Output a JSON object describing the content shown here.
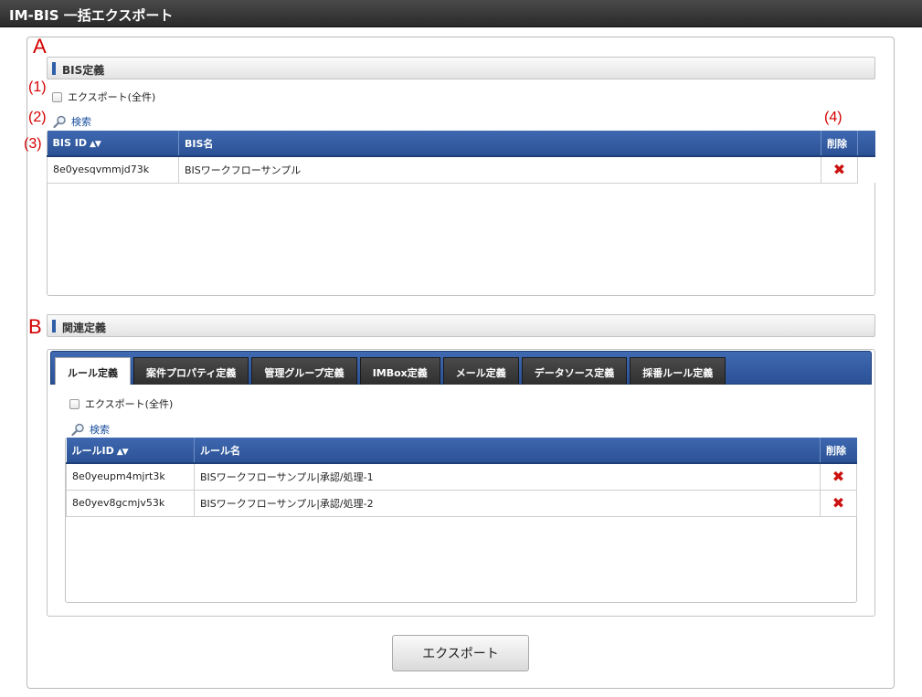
{
  "window": {
    "title": "IM-BIS 一括エクスポート"
  },
  "markers": {
    "a": "A",
    "b": "B",
    "m1": "(1)",
    "m2": "(2)",
    "m3": "(3)",
    "m4": "(4)"
  },
  "bis_section": {
    "title": "BIS定義",
    "export_all_label": "エクスポート(全件)",
    "search_label": "検索",
    "columns": {
      "id": "BIS ID",
      "name": "BIS名",
      "delete": "削除"
    },
    "rows": [
      {
        "id": "8e0yesqvmmjd73k",
        "name": "BISワークフローサンプル"
      }
    ]
  },
  "related_section": {
    "title": "関連定義",
    "tabs": [
      "ルール定義",
      "案件プロパティ定義",
      "管理グループ定義",
      "IMBox定義",
      "メール定義",
      "データソース定義",
      "採番ルール定義"
    ],
    "active_tab": 0,
    "export_all_label": "エクスポート(全件)",
    "search_label": "検索",
    "columns": {
      "id": "ルールID",
      "name": "ルール名",
      "delete": "削除"
    },
    "rows": [
      {
        "id": "8e0yeupm4mjrt3k",
        "name": "BISワークフローサンプル|承認/処理-1"
      },
      {
        "id": "8e0yev8gcmjv53k",
        "name": "BISワークフローサンプル|承認/処理-2"
      }
    ]
  },
  "actions": {
    "export_button": "エクスポート"
  },
  "icons": {
    "search": "search-icon",
    "delete": "delete-icon",
    "sort": "sort-icon"
  },
  "colors": {
    "header_blue": "#2c5296",
    "delete_red": "#cc1111",
    "marker_red": "#d40000"
  }
}
